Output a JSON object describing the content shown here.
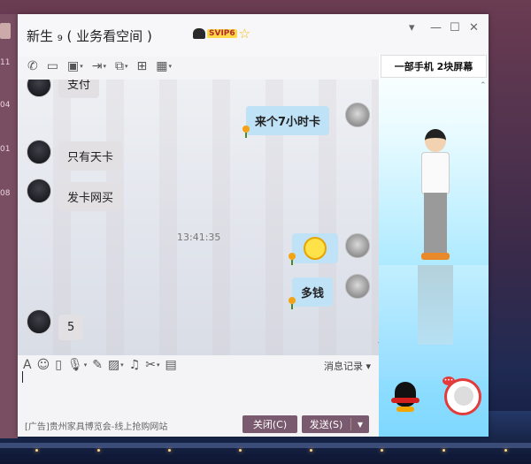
{
  "window": {
    "title": "新生   ₉ ( 业务看空间 )",
    "svip_badge": "SVIP6"
  },
  "behind_panel": {
    "labels": [
      "11",
      "04",
      "01",
      "08"
    ]
  },
  "toolbar": {
    "icons": [
      "phone-icon",
      "video-icon",
      "screen-share-icon",
      "transfer-icon",
      "remote-desktop-icon",
      "add-app-icon",
      "apps-grid-icon"
    ]
  },
  "messages": [
    {
      "from": "other",
      "text": "支付"
    },
    {
      "from": "me",
      "text": "来个7小时卡"
    },
    {
      "from": "other",
      "text": "只有天卡"
    },
    {
      "from": "other",
      "text": "发卡网买"
    },
    {
      "from": "system",
      "text": "13:41:35"
    },
    {
      "from": "me",
      "emoji": "confused-emoji"
    },
    {
      "from": "me",
      "text": "多钱"
    },
    {
      "from": "other",
      "text": "5"
    }
  ],
  "input_toolbar": {
    "history_label": "消息记录",
    "icons": [
      "font-icon",
      "emoji-icon",
      "gif-icon",
      "voice-icon",
      "handwrite-icon",
      "image-icon",
      "music-icon",
      "screenshot-icon",
      "folder-icon"
    ]
  },
  "footer": {
    "ad": "[广告]贵州家具博览会-线上抢购网站",
    "close_label": "关闭(C)",
    "send_label": "发送(S)"
  },
  "side_show": {
    "banner": "一部手机  2块屏幕"
  }
}
